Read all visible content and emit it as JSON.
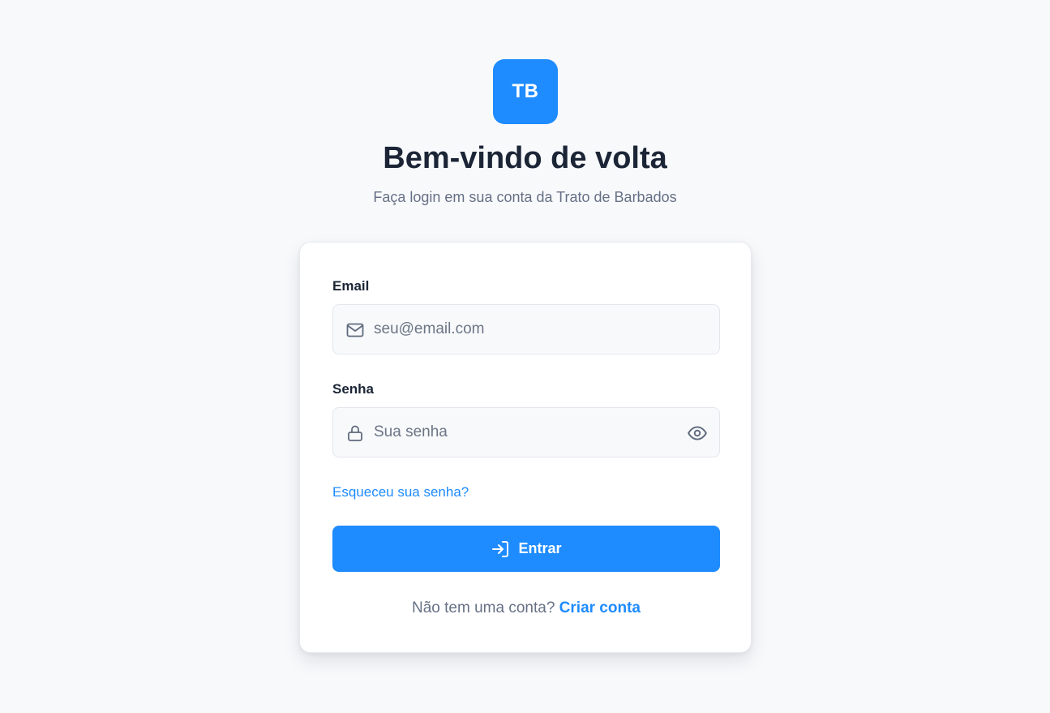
{
  "brand": {
    "logo_text": "TB",
    "accent": "#1e8bff"
  },
  "header": {
    "title": "Bem-vindo de volta",
    "subtitle": "Faça login em sua conta da Trato de Barbados"
  },
  "form": {
    "email": {
      "label": "Email",
      "value": "",
      "placeholder": "seu@email.com",
      "icon": "mail-icon"
    },
    "password": {
      "label": "Senha",
      "value": "",
      "placeholder": "Sua senha",
      "icon": "lock-icon",
      "toggle_icon": "eye-icon"
    },
    "forgot_link": "Esqueceu sua senha?",
    "submit_label": "Entrar",
    "submit_icon": "login-icon"
  },
  "footer": {
    "prompt": "Não tem uma conta?",
    "signup_link": "Criar conta"
  }
}
